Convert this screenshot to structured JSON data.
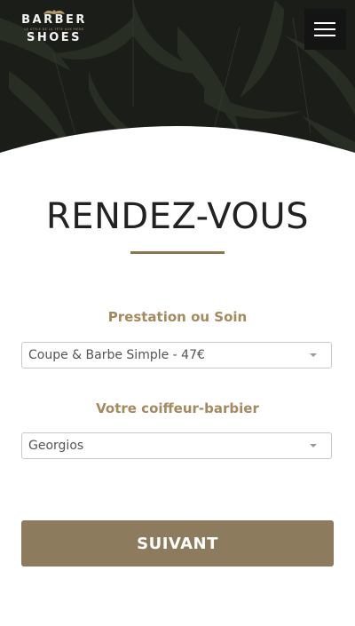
{
  "header": {
    "logo": {
      "line1": "BARBER",
      "tagline": "LE STYLE DE LA TÊTE AUX PIEDS",
      "line2": "SHOES"
    },
    "menu_icon": "hamburger-menu-icon"
  },
  "page": {
    "title": "RENDEZ-VOUS"
  },
  "form": {
    "prestation": {
      "label": "Prestation ou Soin",
      "value": "Coupe & Barbe Simple - 47€"
    },
    "coiffeur": {
      "label": "Votre coiffeur-barbier",
      "value": "Georgios"
    },
    "submit_label": "SUIVANT"
  },
  "colors": {
    "accent_gold": "#a48a5d",
    "button_bg": "#8c7b5d",
    "hero_bg": "#1a1d18"
  }
}
